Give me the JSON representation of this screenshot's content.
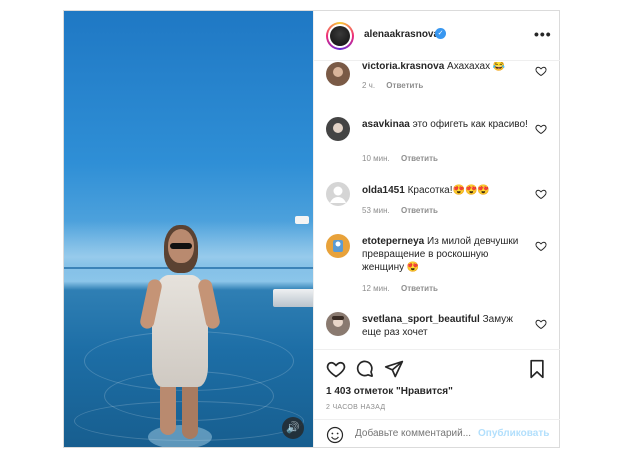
{
  "post": {
    "author": {
      "username": "alenaakrasnova",
      "verified_icon": "verified-badge-icon",
      "more_icon": "more-options-icon"
    },
    "media": {
      "sound_icon": "speaker-icon"
    },
    "comments": [
      {
        "username": "victoria.krasnova",
        "text": "Ахахахах 😂",
        "time": "2 ч.",
        "reply": "Ответить",
        "avatar_color": "#7a5a46"
      },
      {
        "username": "asavkinaa",
        "text": "это офигеть как красиво!",
        "time": "10 мин.",
        "reply": "Ответить",
        "avatar_color": "#444444"
      },
      {
        "username": "olda1451",
        "text": "Красотка!😍😍😍",
        "time": "53 мин.",
        "reply": "Ответить",
        "avatar_color": "#d5d5d5"
      },
      {
        "username": "etoteperneya",
        "text": "Из милой девчушки превращение в роскошную женщину 😍",
        "time": "12 мин.",
        "reply": "Ответить",
        "avatar_color": "#e8a23a"
      },
      {
        "username": "svetlana_sport_beautiful",
        "text": "Замуж еще раз хочет",
        "time": "",
        "reply": "",
        "avatar_color": "#8a7a70"
      }
    ],
    "likes_text": "1 403 отметок \"Нравится\"",
    "time_ago": "2 ЧАСОВ НАЗАД",
    "add_comment": {
      "placeholder": "Добавьте комментарий...",
      "publish_label": "Опубликовать"
    },
    "colors": {
      "accent": "#3897f0",
      "publish_disabled": "#b2dffc",
      "muted": "#8e8e8e"
    }
  }
}
